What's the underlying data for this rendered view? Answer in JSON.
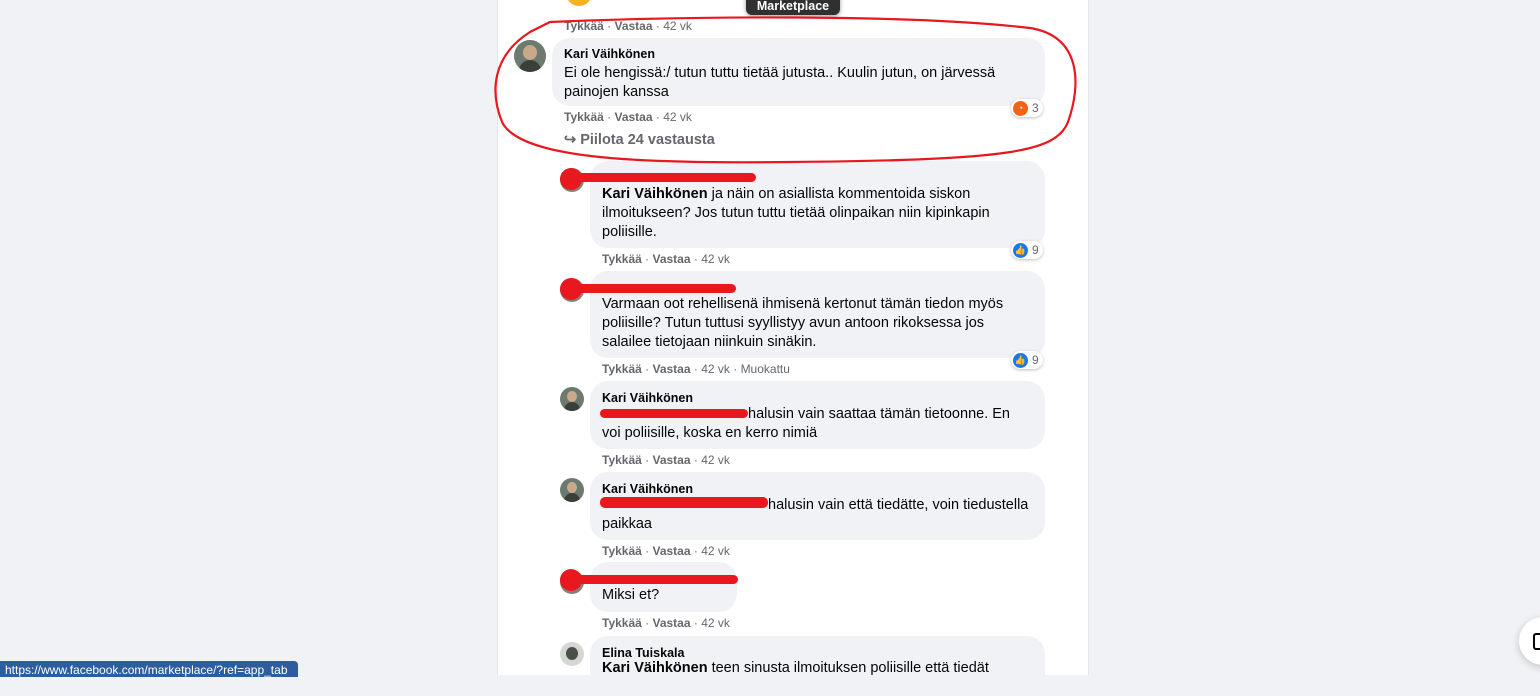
{
  "tooltip": {
    "label": "Marketplace"
  },
  "top_meta": {
    "like": "Tykkää",
    "reply": "Vastaa",
    "age": "42 vk"
  },
  "main_comment": {
    "author": "Kari Väihkönen",
    "text": "Ei ole hengissä:/ tutun tuttu tietää jutusta.. Kuulin jutun, on järvessä painojen kanssa",
    "reaction": {
      "icon": "angry-reaction-icon",
      "count": "3"
    },
    "like": "Tykkää",
    "reply": "Vastaa",
    "age": "42 vk"
  },
  "hide_replies": {
    "label": "Piilota 24 vastausta"
  },
  "replies": [
    {
      "author": "",
      "mention": "Kari Väihkönen",
      "text": " ja näin on asiallista kommentoida siskon ilmoitukseen? Jos tutun tuttu tietää olinpaikan niin kipinkapin poliisille.",
      "reaction": {
        "icon": "like-reaction-icon",
        "count": "9"
      },
      "like": "Tykkää",
      "reply": "Vastaa",
      "age": "42 vk"
    },
    {
      "author": "",
      "text": "Varmaan oot rehellisenä ihmisenä kertonut tämän tiedon myös poliisille? Tutun tuttusi syyllistyy avun antoon rikoksessa jos salailee tietojaan niinkuin sinäkin.",
      "reaction": {
        "icon": "like-reaction-icon",
        "count": "9"
      },
      "like": "Tykkää",
      "reply": "Vastaa",
      "age": "42 vk",
      "edited": "Muokattu"
    },
    {
      "author": "Kari Väihkönen",
      "text": "halusin vain saattaa tämän tietoonne. En voi poliisille, koska en kerro nimiä",
      "like": "Tykkää",
      "reply": "Vastaa",
      "age": "42 vk"
    },
    {
      "author": "Kari Väihkönen",
      "text": "halusin vain että tiedätte, voin tiedustella paikkaa",
      "like": "Tykkää",
      "reply": "Vastaa",
      "age": "42 vk"
    },
    {
      "author": "",
      "text": "Miksi et?",
      "like": "Tykkää",
      "reply": "Vastaa",
      "age": "42 vk"
    },
    {
      "author": "Elina Tuiskala",
      "mention": "Kari Väihkönen",
      "text": " teen sinusta ilmoituksen poliisille että tiedät"
    }
  ],
  "status_bar": {
    "url": "https://www.facebook.com/marketplace/?ref=app_tab"
  },
  "colors": {
    "annotation_red": "#e8181e",
    "bubble_bg": "#f0f2f5",
    "like_blue": "#1877f2",
    "angry_orange": "#f0631b"
  }
}
